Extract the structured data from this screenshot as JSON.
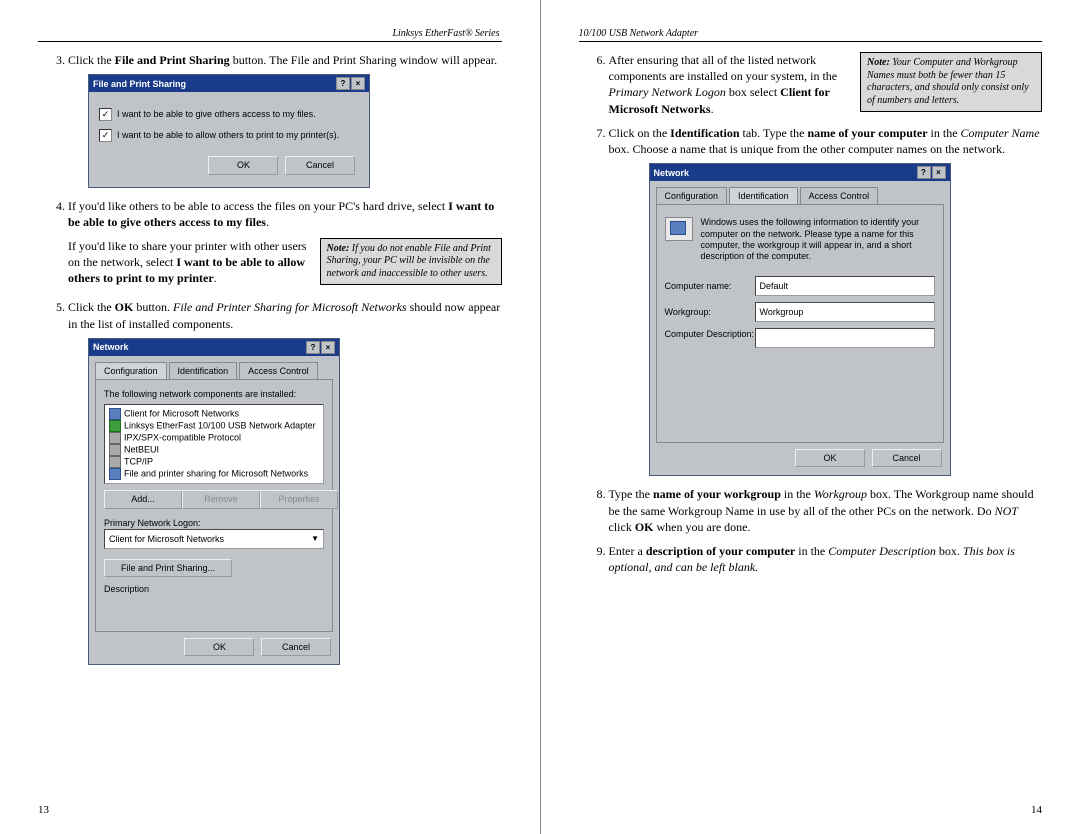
{
  "left": {
    "header": "Linksys EtherFast® Series",
    "pagenum": "13",
    "steps": {
      "s3a": "Click the ",
      "s3b": "File and Print Sharing",
      "s3c": " button. The File and Print Sharing window will appear.",
      "s4a": "If you'd like others to be able to access the files on your PC's hard drive, select ",
      "s4b": "I want to be able to give others access to my files",
      "s4c": ".",
      "s4_para2a": "If you'd like to share your printer with other users on the network, select ",
      "s4_para2b": "I want to be able to allow others to print to my printer",
      "s4_para2c": ".",
      "s5a": "Click the ",
      "s5b": "OK",
      "s5c": " button. ",
      "s5d": "File and Printer Sharing for Microsoft Networks",
      "s5e": " should now appear in the list of installed components."
    },
    "note1": {
      "label": "Note:",
      "text": " If you do not enable File and Print Sharing, your PC will be invisible on the network and inaccessible to other users."
    },
    "dlg1": {
      "title": "File and Print Sharing",
      "chk1": "I want to be able to give others access to my files.",
      "chk2": "I want to be able to allow others to print to my printer(s).",
      "ok": "OK",
      "cancel": "Cancel"
    },
    "dlg2": {
      "title": "Network",
      "tab1": "Configuration",
      "tab2": "Identification",
      "tab3": "Access Control",
      "list_label": "The following network components are installed:",
      "items": [
        "Client for Microsoft Networks",
        "Linksys EtherFast 10/100 USB Network Adapter",
        "IPX/SPX-compatible Protocol",
        "NetBEUI",
        "TCP/IP",
        "File and printer sharing for Microsoft Networks"
      ],
      "add": "Add...",
      "remove": "Remove",
      "properties": "Properties",
      "logon_label": "Primary Network Logon:",
      "logon_value": "Client for Microsoft Networks",
      "fps_btn": "File and Print Sharing...",
      "desc_label": "Description",
      "ok": "OK",
      "cancel": "Cancel"
    }
  },
  "right": {
    "header": "10/100 USB Network Adapter",
    "pagenum": "14",
    "note2": {
      "label": "Note:",
      "text": " Your Computer and Workgroup Names must both be fewer than 15 characters, and should only consist only of numbers and letters."
    },
    "steps": {
      "s6a": "After ensuring that all of the listed network components are installed on your system, in the ",
      "s6b": "Primary Network Logon",
      "s6c": " box select ",
      "s6d": "Client for Microsoft Networks",
      "s6e": ".",
      "s7a": "Click on the ",
      "s7b": "Identification",
      "s7c": " tab. Type the ",
      "s7d": "name of your computer",
      "s7e": " in the ",
      "s7f": "Computer Name",
      "s7g": " box. Choose a name that is unique from the other computer names on the network.",
      "s8a": "Type the ",
      "s8b": "name of your workgroup",
      "s8c": " in the ",
      "s8d": "Workgroup",
      "s8e": " box. The Workgroup name should be the same Workgroup Name in use by all of the other PCs on the network. Do ",
      "s8f": "NOT",
      "s8g": " click ",
      "s8h": "OK",
      "s8i": " when you are done.",
      "s9a": "Enter a ",
      "s9b": "description of your computer",
      "s9c": " in the ",
      "s9d": "Computer Description",
      "s9e": " box. ",
      "s9f": "This box is optional, and can be left blank."
    },
    "dlg3": {
      "title": "Network",
      "tab1": "Configuration",
      "tab2": "Identification",
      "tab3": "Access Control",
      "info": "Windows uses the following information to identify your computer on the network. Please type a name for this computer, the workgroup it will appear in, and a short description of the computer.",
      "f1_label": "Computer name:",
      "f1_val": "Default",
      "f2_label": "Workgroup:",
      "f2_val": "Workgroup",
      "f3_label": "Computer Description:",
      "f3_val": "",
      "ok": "OK",
      "cancel": "Cancel"
    }
  }
}
